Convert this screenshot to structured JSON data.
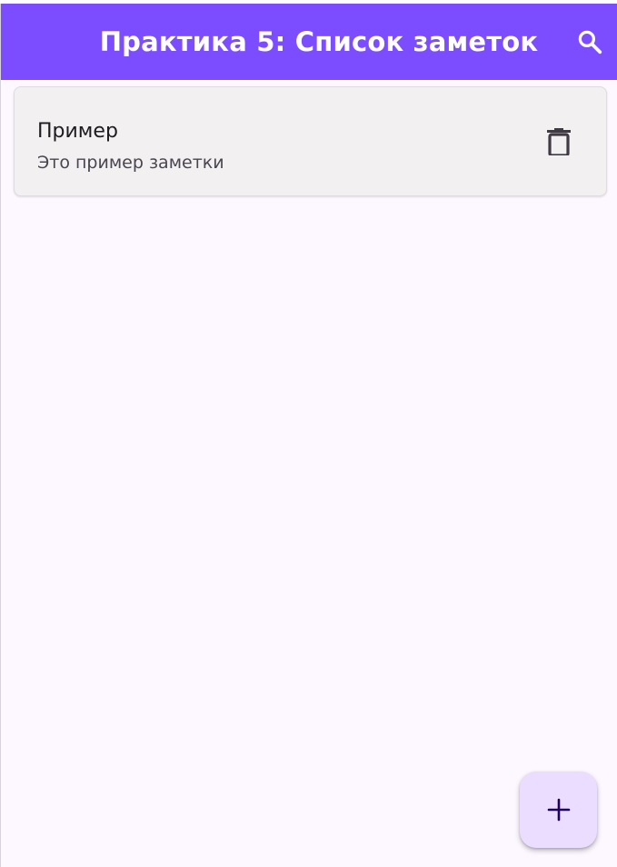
{
  "app_bar": {
    "title": "Практика 5: Список заметок",
    "background": "#7c4dff",
    "search_icon": "search-icon"
  },
  "notes": [
    {
      "title": "Пример",
      "text": "Это пример заметки",
      "action_icon": "trash-icon"
    }
  ],
  "fab": {
    "icon": "plus-icon",
    "background": "#ebddff",
    "icon_color": "#21005d"
  },
  "colors": {
    "page_background": "#fdf7ff",
    "card_background": "#f3f0f1"
  }
}
